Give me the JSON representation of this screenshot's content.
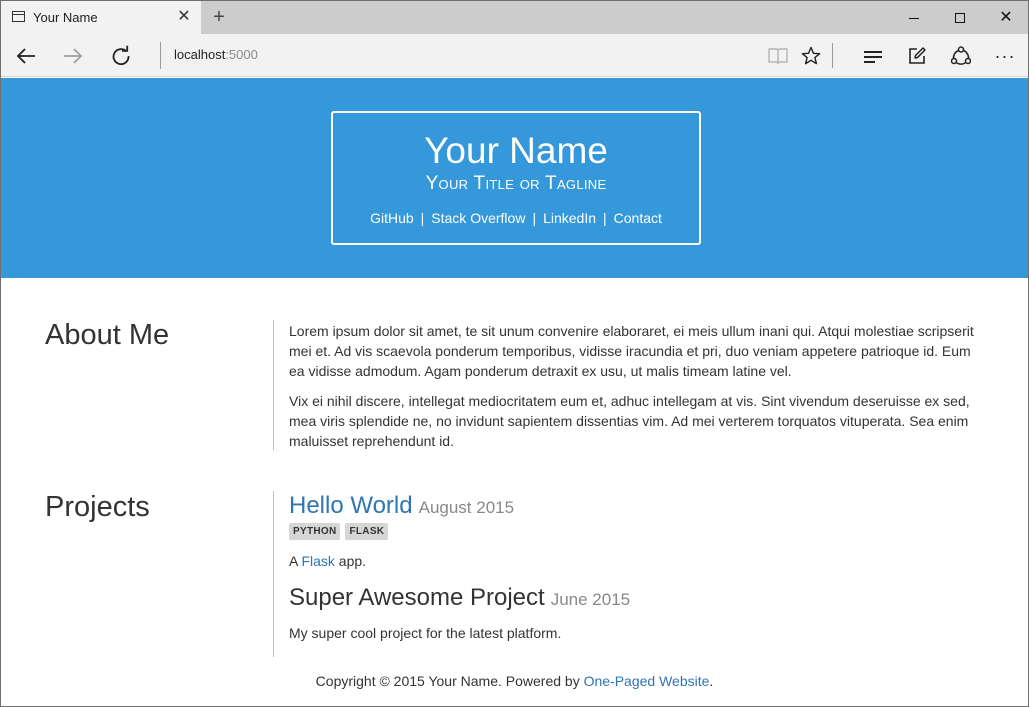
{
  "browser": {
    "tab_title": "Your Name",
    "tab_close": "✕",
    "new_tab": "+",
    "address_host": "localhost",
    "address_port": ":5000"
  },
  "header": {
    "name": "Your Name",
    "tagline": "Your Title or Tagline",
    "links": [
      "GitHub",
      "Stack Overflow",
      "LinkedIn",
      "Contact"
    ],
    "separator": "|"
  },
  "about": {
    "title": "About Me",
    "paragraphs": [
      "Lorem ipsum dolor sit amet, te sit unum convenire elaboraret, ei meis ullum inani qui. Atqui molestiae scripserit mei et. Ad vis scaevola ponderum temporibus, vidisse iracundia et pri, duo veniam appetere patrioque id. Eum ea vidisse admodum. Agam ponderum detraxit ex usu, ut malis timeam latine vel.",
      "Vix ei nihil discere, intellegat mediocritatem eum et, adhuc intellegam at vis. Sint vivendum deseruisse ex sed, mea viris splendide ne, no invidunt sapientem dissentias vim. Ad mei verterem torquatos vituperata. Sea enim maluisset reprehendunt id."
    ]
  },
  "projects": {
    "title": "Projects",
    "items": [
      {
        "name": "Hello World",
        "date": "August 2015",
        "tags": [
          "PYTHON",
          "FLASK"
        ],
        "desc_prefix": "A ",
        "desc_link": "Flask",
        "desc_suffix": " app."
      },
      {
        "name": "Super Awesome Project",
        "date": "June 2015",
        "desc": "My super cool project for the latest platform."
      }
    ]
  },
  "footer": {
    "text": "Copyright © 2015 Your Name. Powered by ",
    "link": "One-Paged Website",
    "end": "."
  },
  "colors": {
    "header_bg": "#3498db",
    "link": "#2e75b6"
  }
}
